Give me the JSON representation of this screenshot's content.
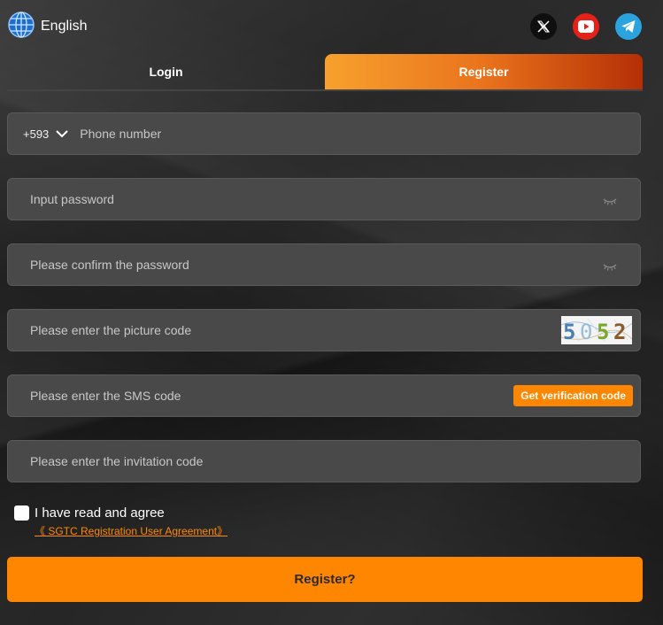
{
  "header": {
    "language": "English",
    "icons": {
      "language": "globe-icon",
      "x": "x-twitter-icon",
      "youtube": "youtube-icon",
      "telegram": "telegram-icon"
    }
  },
  "tabs": [
    {
      "label": "Login",
      "active": false
    },
    {
      "label": "Register",
      "active": true
    }
  ],
  "form": {
    "country_code": "+593",
    "phone_placeholder": "Phone number",
    "password_placeholder": "Input password",
    "confirm_placeholder": "Please confirm the password",
    "picture_code_placeholder": "Please enter the picture code",
    "captcha_text": "5052",
    "sms_placeholder": "Please enter the SMS code",
    "sms_button": "Get verification code",
    "invite_placeholder": "Please enter the invitation code"
  },
  "agreement": {
    "label": "I have read and agree",
    "link": "《 SGTC Registration User Agreement》",
    "checked": false
  },
  "submit_label": "Register?",
  "colors": {
    "accent": "#fe8600",
    "field_bg": "#494949",
    "youtube": "#e62117",
    "telegram": "#2aa3df"
  }
}
